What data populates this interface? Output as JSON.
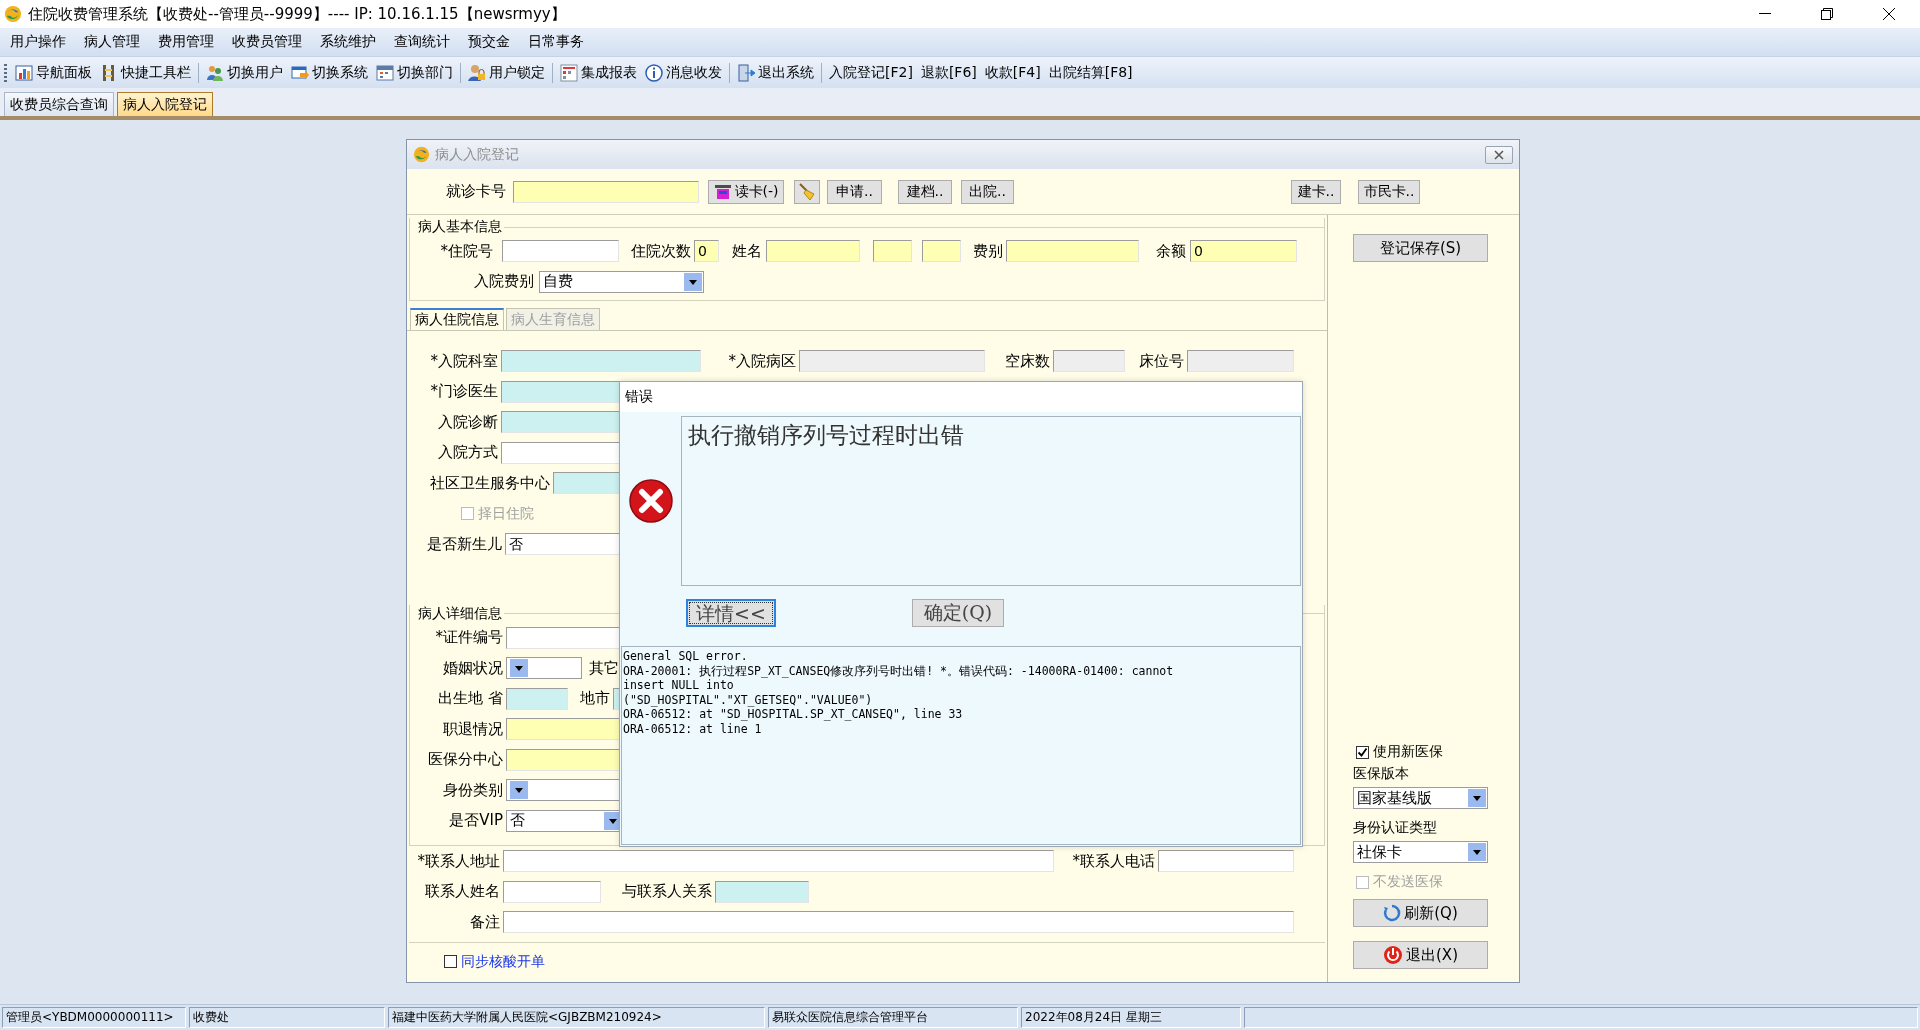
{
  "app": {
    "title": "住院收费管理系统【收费处--管理员--9999】---- IP:  10.16.1.15【newsrmyy】"
  },
  "menu": [
    "用户操作",
    "病人管理",
    "费用管理",
    "收费员管理",
    "系统维护",
    "查询统计",
    "预交金",
    "日常事务"
  ],
  "toolbar": [
    {
      "items": [
        {
          "label": "导航面板",
          "kind": "icon_text"
        },
        {
          "label": "快捷工具栏",
          "kind": "icon_text"
        }
      ]
    },
    {
      "items": [
        {
          "label": "切换用户",
          "kind": "icon_text"
        },
        {
          "label": "切换系统",
          "kind": "icon_text"
        },
        {
          "label": "切换部门",
          "kind": "icon_text"
        }
      ]
    },
    {
      "items": [
        {
          "label": "用户锁定",
          "kind": "icon_text"
        }
      ]
    },
    {
      "items": [
        {
          "label": "集成报表",
          "kind": "icon_text"
        },
        {
          "label": "消息收发",
          "kind": "icon_text"
        }
      ]
    },
    {
      "items": [
        {
          "label": "退出系统",
          "kind": "icon_text"
        }
      ]
    },
    {
      "items": [
        {
          "label": "入院登记[F2]",
          "kind": "text"
        },
        {
          "label": "退款[F6]",
          "kind": "text"
        },
        {
          "label": "收款[F4]",
          "kind": "text"
        },
        {
          "label": "出院结算[F8]",
          "kind": "text"
        }
      ]
    }
  ],
  "doc_tabs": [
    {
      "label": "收费员综合查询",
      "selected": false
    },
    {
      "label": "病人入院登记",
      "selected": true
    }
  ],
  "child_window": {
    "title": "病人入院登记",
    "card_row": [
      {
        "kind": "label",
        "text": "就诊卡号"
      },
      {
        "kind": "field",
        "color": "#ffffb3"
      },
      {
        "kind": "button",
        "text": "读卡(-)",
        "icon": true
      },
      {
        "kind": "icon_button"
      },
      {
        "kind": "button",
        "text": "申请..",
        "icon": false
      },
      {
        "kind": "button",
        "text": "建档..",
        "icon": false
      },
      {
        "kind": "button",
        "text": "出院..",
        "icon": false
      },
      {
        "kind": "button",
        "text": "建卡..",
        "icon": false
      },
      {
        "kind": "button",
        "text": "市民卡..",
        "icon": false
      }
    ],
    "basic_info": {
      "title": "病人基本信息",
      "rows": [
        [
          {
            "kind": "label",
            "text": "*住院号"
          },
          {
            "kind": "field",
            "color": "#ffffff"
          },
          {
            "kind": "label",
            "text": "住院次数"
          },
          {
            "kind": "field",
            "color": "#ffffb3",
            "value": "0"
          },
          {
            "kind": "label",
            "text": "姓名"
          },
          {
            "kind": "field",
            "color": "#ffffb3"
          },
          {
            "kind": "field",
            "color": "#ffffb3"
          },
          {
            "kind": "field",
            "color": "#ffffb3"
          },
          {
            "kind": "label",
            "text": "费别"
          },
          {
            "kind": "field",
            "color": "#ffffb3"
          },
          {
            "kind": "label",
            "text": "余额"
          },
          {
            "kind": "field",
            "color": "#ffffb3",
            "value": "0"
          }
        ],
        [
          {
            "kind": "label",
            "text": "入院费别"
          },
          {
            "kind": "combo",
            "value": "自费"
          }
        ]
      ]
    },
    "tabs": [
      {
        "label": "病人住院信息",
        "selected": true
      },
      {
        "label": "病人生育信息",
        "selected": false
      }
    ],
    "admission_info": {
      "rows": [
        [
          {
            "kind": "label",
            "text": "*入院科室"
          },
          {
            "kind": "field",
            "color": "#cdf1f1"
          },
          {
            "kind": "label",
            "text": "*入院病区"
          },
          {
            "kind": "field",
            "color": "#eeeeee"
          },
          {
            "kind": "label",
            "text": "空床数"
          },
          {
            "kind": "field",
            "color": "#eeeeee"
          },
          {
            "kind": "label",
            "text": "床位号"
          },
          {
            "kind": "field",
            "color": "#eeeeee"
          }
        ],
        [
          {
            "kind": "label",
            "text": "*门诊医生"
          },
          {
            "kind": "field",
            "color": "#cdf1f1"
          }
        ],
        [
          {
            "kind": "label",
            "text": "入院诊断"
          },
          {
            "kind": "field",
            "color": "#cdf1f1"
          }
        ],
        [
          {
            "kind": "label",
            "text": "入院方式"
          },
          {
            "kind": "field",
            "color": "#ffffff"
          }
        ],
        [
          {
            "kind": "label",
            "text": "社区卫生服务中心"
          },
          {
            "kind": "field",
            "color": "#cdf1f1"
          }
        ],
        [
          {
            "kind": "checkbox",
            "label": "择日住院",
            "checked": false,
            "disabled": true
          }
        ],
        [
          {
            "kind": "label",
            "text": "是否新生儿"
          },
          {
            "kind": "field",
            "color": "#ffffff",
            "value": "否"
          }
        ]
      ]
    },
    "detail_info": {
      "title": "病人详细信息",
      "rows": [
        [
          {
            "kind": "label",
            "text": "*证件编号"
          },
          {
            "kind": "field",
            "color": "#ffffff"
          }
        ],
        [
          {
            "kind": "label",
            "text": "婚姻状况"
          },
          {
            "kind": "combo"
          },
          {
            "kind": "label",
            "text": "其它"
          }
        ],
        [
          {
            "kind": "label",
            "text": "出生地 省"
          },
          {
            "kind": "field",
            "color": "#cdf1f1"
          },
          {
            "kind": "label",
            "text": "地市"
          },
          {
            "kind": "field",
            "color": "#cdf1f1"
          }
        ],
        [
          {
            "kind": "label",
            "text": "职退情况"
          },
          {
            "kind": "field",
            "color": "#ffffb3"
          }
        ],
        [
          {
            "kind": "label",
            "text": "医保分中心"
          },
          {
            "kind": "field",
            "color": "#ffffb3"
          }
        ],
        [
          {
            "kind": "label",
            "text": "身份类别"
          },
          {
            "kind": "combo"
          }
        ],
        [
          {
            "kind": "label",
            "text": "是否VIP"
          },
          {
            "kind": "combo",
            "value": "否"
          }
        ]
      ]
    },
    "contact_info": {
      "rows": [
        [
          {
            "kind": "label",
            "text": "*联系人地址"
          },
          {
            "kind": "field",
            "color": "#ffffff"
          },
          {
            "kind": "label",
            "text": "*联系人电话"
          },
          {
            "kind": "field",
            "color": "#ffffff"
          }
        ],
        [
          {
            "kind": "label",
            "text": "联系人姓名"
          },
          {
            "kind": "field",
            "color": "#ffffff"
          },
          {
            "kind": "label",
            "text": "与联系人关系"
          },
          {
            "kind": "field",
            "color": "#cdf1f1"
          }
        ],
        [
          {
            "kind": "label",
            "text": "备注"
          },
          {
            "kind": "field",
            "color": "#ffffff"
          }
        ]
      ]
    },
    "footer": [
      {
        "kind": "checkbox_link",
        "label": "同步核酸开单",
        "checked": false,
        "disabled": false
      }
    ],
    "right_panel": {
      "save_button": "登记保存(S)",
      "options": [
        {
          "kind": "checkbox",
          "label": "使用新医保",
          "checked": true,
          "disabled": false
        },
        {
          "kind": "label",
          "text": "医保版本"
        },
        {
          "kind": "combo",
          "value": "国家基线版"
        },
        {
          "kind": "label",
          "text": "身份认证类型"
        },
        {
          "kind": "combo",
          "value": "社保卡"
        },
        {
          "kind": "checkbox",
          "label": "不发送医保",
          "checked": false,
          "disabled": true
        }
      ],
      "buttons": [
        "刷新(Q)",
        "退出(X)"
      ]
    }
  },
  "error_dialog": {
    "title": "错误",
    "message": "执行撤销序列号过程时出错",
    "buttons": [
      {
        "label": "详情<<",
        "focused": true
      },
      {
        "label": "确定(Q)",
        "focused": false
      }
    ],
    "details": [
      "General SQL error.",
      "ORA-20001: 执行过程SP_XT_CANSEQ修改序列号时出错! *。错误代码: -14000RA-01400: cannot",
      "insert NULL into",
      "(\"SD_HOSPITAL\".\"XT_GETSEQ\".\"VALUE0\")",
      "ORA-06512: at \"SD_HOSPITAL.SP_XT_CANSEQ\", line 33",
      "ORA-06512: at line 1"
    ]
  },
  "status_bar": [
    "管理员<YBDM0000000111>",
    "收费处",
    "福建中医药大学附属人民医院<GJBZBM210924>",
    "易联众医院信息综合管理平台",
    "2022年08月24日 星期三"
  ]
}
